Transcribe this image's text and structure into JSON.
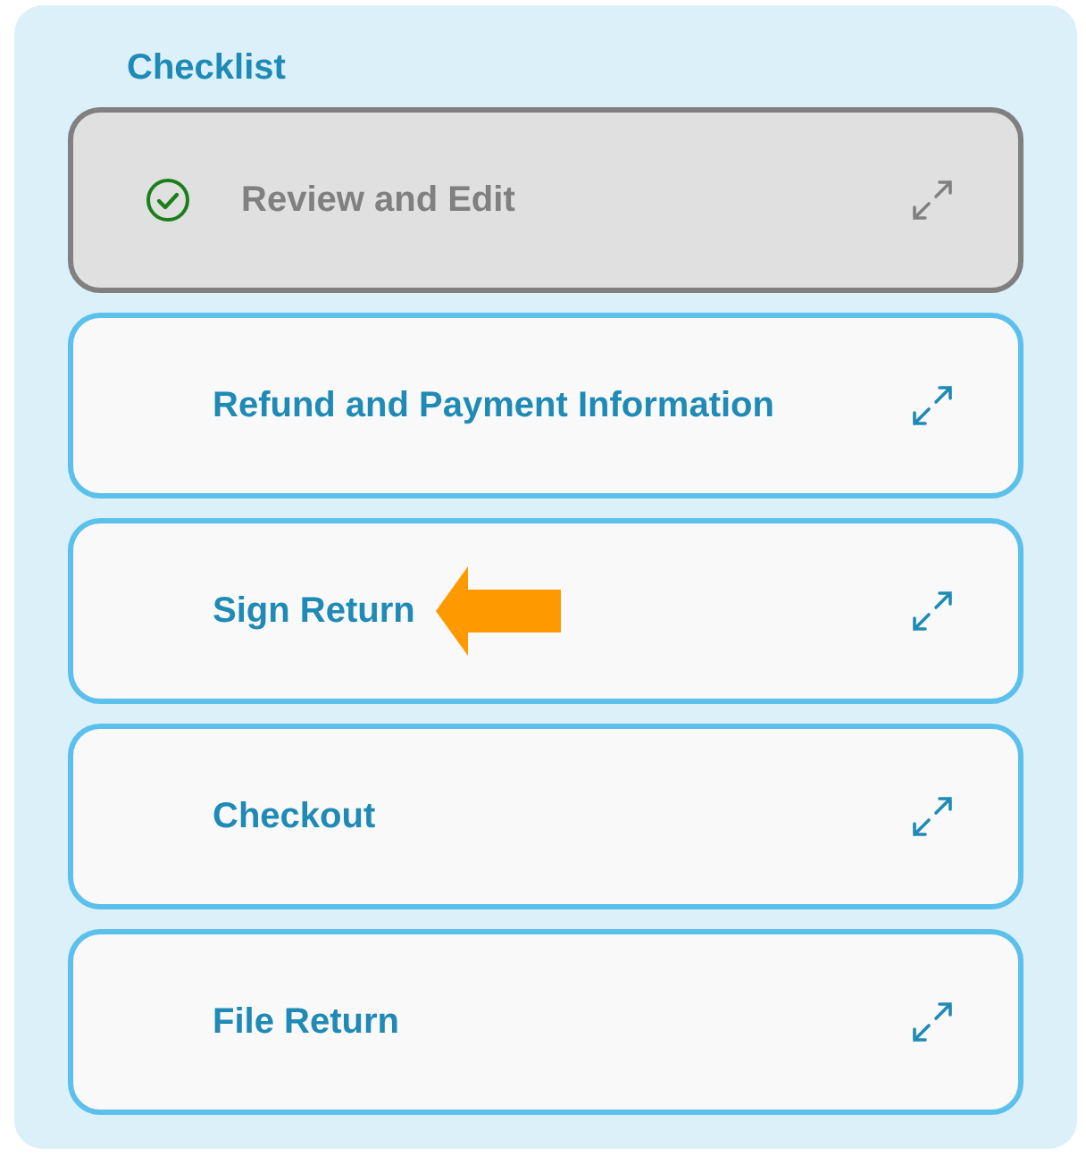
{
  "title": "Checklist",
  "items": [
    {
      "label": "Review and Edit",
      "completed": true,
      "arrow": false
    },
    {
      "label": "Refund and Payment Information",
      "completed": false,
      "arrow": false
    },
    {
      "label": "Sign Return",
      "completed": false,
      "arrow": true
    },
    {
      "label": "Checkout",
      "completed": false,
      "arrow": false
    },
    {
      "label": "File Return",
      "completed": false,
      "arrow": false
    }
  ]
}
